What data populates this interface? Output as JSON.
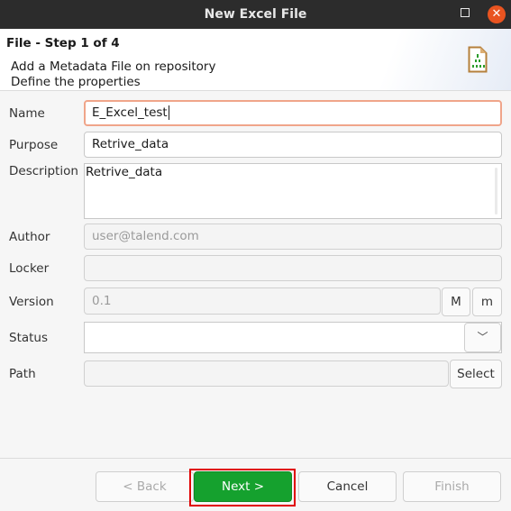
{
  "window": {
    "title": "New Excel File",
    "maximize_icon": "maximize-icon",
    "close_icon": "close-icon",
    "close_glyph": "✕"
  },
  "header": {
    "step": "File - Step 1 of 4",
    "line1": "Add a Metadata File on repository",
    "line2": "Define the properties",
    "icon": "excel-file-icon"
  },
  "form": {
    "name": {
      "label": "Name",
      "value": "E_Excel_test"
    },
    "purpose": {
      "label": "Purpose",
      "value": "Retrive_data"
    },
    "description": {
      "label": "Description",
      "value": "Retrive_data"
    },
    "author": {
      "label": "Author",
      "value": "user@talend.com"
    },
    "locker": {
      "label": "Locker",
      "value": ""
    },
    "version": {
      "label": "Version",
      "value": "0.1",
      "major_button": "M",
      "minor_button": "m"
    },
    "status": {
      "label": "Status",
      "value": "",
      "dropdown_glyph": "﹀"
    },
    "path": {
      "label": "Path",
      "value": "",
      "select_button": "Select"
    }
  },
  "footer": {
    "back": "< Back",
    "next": "Next >",
    "cancel": "Cancel",
    "finish": "Finish"
  },
  "colors": {
    "primary": "#15a12e",
    "close": "#e95420",
    "focus_border": "#f0a58a",
    "highlight": "#e00000"
  }
}
